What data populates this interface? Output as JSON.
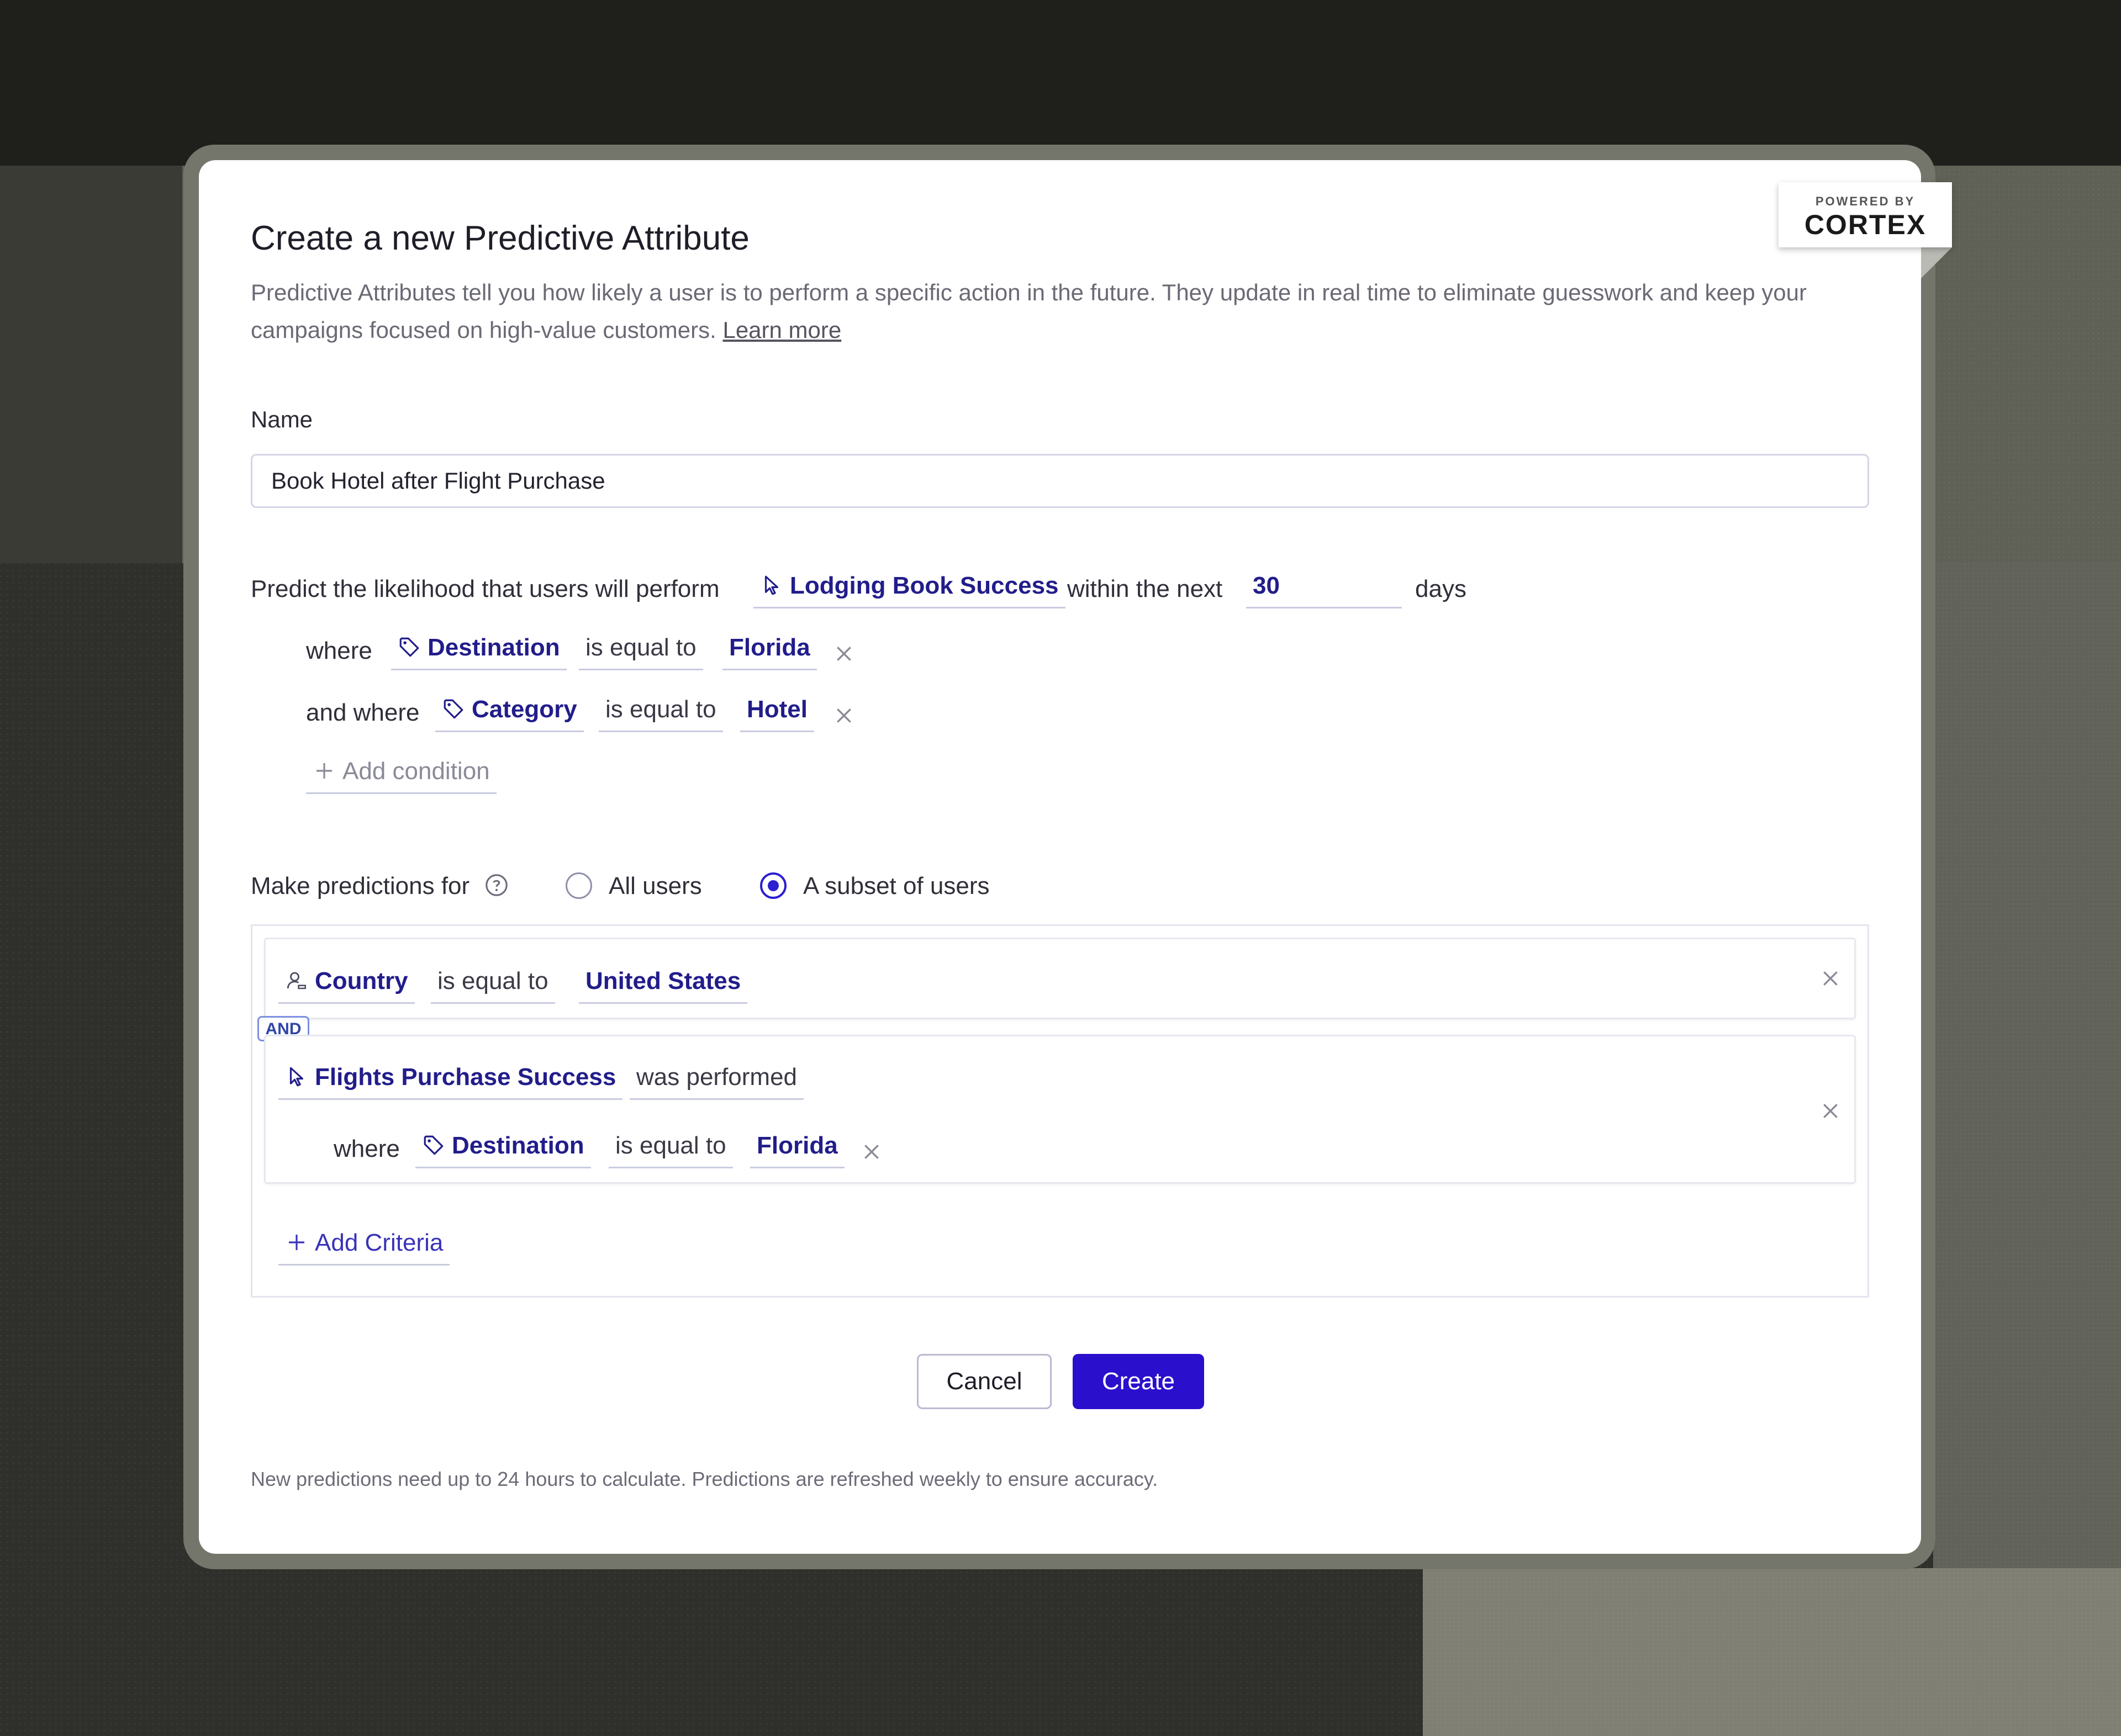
{
  "badge": {
    "small": "POWERED BY",
    "big": "CORTEX"
  },
  "dialog": {
    "title": "Create a new Predictive Attribute",
    "description": "Predictive Attributes tell you how likely a user is to perform a specific action in the future. They update in real time to eliminate guesswork and keep your campaigns focused on high-value customers.",
    "learn_more": "Learn more"
  },
  "name": {
    "label": "Name",
    "value": "Book Hotel after Flight Purchase"
  },
  "predict": {
    "lead": "Predict the likelihood that users will perform",
    "event": "Lodging Book Success",
    "within": "within the next",
    "days_value": "30",
    "days_label": "days",
    "conditions": [
      {
        "prefix": "where",
        "property": "Destination",
        "operator": "is equal to",
        "value": "Florida"
      },
      {
        "prefix": "and where",
        "property": "Category",
        "operator": "is equal to",
        "value": "Hotel"
      }
    ],
    "add_condition": "Add condition"
  },
  "predictions_for": {
    "label": "Make predictions for",
    "options": [
      "All users",
      "A subset of users"
    ],
    "selected": "A subset of users"
  },
  "criteria": [
    {
      "property": "Country",
      "operator": "is equal to",
      "value": "United States"
    },
    {
      "event": "Flights Purchase Success",
      "action": "was performed",
      "where": {
        "prefix": "where",
        "property": "Destination",
        "operator": "is equal to",
        "value": "Florida"
      }
    }
  ],
  "and_label": "AND",
  "add_criteria": "Add Criteria",
  "buttons": {
    "cancel": "Cancel",
    "create": "Create"
  },
  "footnote": "New predictions need up to 24 hours to calculate. Predictions are refreshed weekly to ensure accuracy.",
  "colors": {
    "accent": "#2a0fcc",
    "token_text": "#221d8a",
    "modal_bg": "#ffffff"
  }
}
